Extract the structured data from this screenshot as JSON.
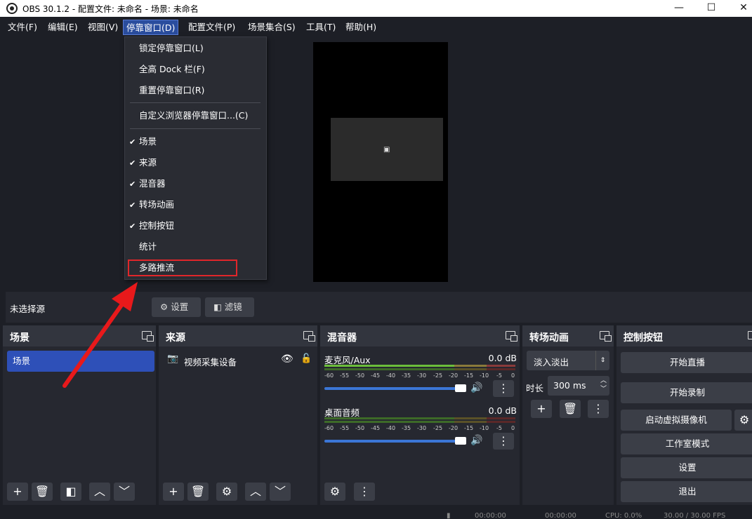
{
  "window": {
    "title": "OBS 30.1.2 - 配置文件: 未命名 - 场景: 未命名",
    "minimize": "—",
    "maximize": "☐",
    "close": "✕"
  },
  "menubar": {
    "items": [
      {
        "label": "文件(F)"
      },
      {
        "label": "编辑(E)"
      },
      {
        "label": "视图(V)"
      },
      {
        "label": "停靠窗口(D)"
      },
      {
        "label": "配置文件(P)"
      },
      {
        "label": "场景集合(S)"
      },
      {
        "label": "工具(T)"
      },
      {
        "label": "帮助(H)"
      }
    ]
  },
  "dock_menu": {
    "items": [
      {
        "label": "锁定停靠窗口(L)",
        "checked": false
      },
      {
        "label": "全高 Dock 栏(F)",
        "checked": false
      },
      {
        "label": "重置停靠窗口(R)",
        "checked": false
      },
      {
        "label": "自定义浏览器停靠窗口...(C)",
        "checked": false
      },
      {
        "label": "场景",
        "checked": true
      },
      {
        "label": "来源",
        "checked": true
      },
      {
        "label": "混音器",
        "checked": true
      },
      {
        "label": "转场动画",
        "checked": true
      },
      {
        "label": "控制按钮",
        "checked": true
      },
      {
        "label": "统计",
        "checked": false
      },
      {
        "label": "多路推流",
        "checked": false
      }
    ],
    "check_glyph": "✔"
  },
  "source_toolbar": {
    "no_source": "未选择源",
    "settings_label": "设置",
    "filters_label": "滤镜"
  },
  "scenes_dock": {
    "title": "场景",
    "items": [
      {
        "label": "场景"
      }
    ]
  },
  "sources_dock": {
    "title": "来源",
    "items": [
      {
        "label": "视频采集设备"
      }
    ]
  },
  "mixer_dock": {
    "title": "混音器",
    "channels": [
      {
        "name": "麦克风/Aux",
        "db": "0.0 dB"
      },
      {
        "name": "桌面音频",
        "db": "0.0 dB"
      }
    ],
    "ticks": [
      "-60",
      "-55",
      "-50",
      "-45",
      "-40",
      "-35",
      "-30",
      "-25",
      "-20",
      "-15",
      "-10",
      "-5",
      "0"
    ]
  },
  "transitions_dock": {
    "title": "转场动画",
    "selected": "淡入淡出",
    "duration_label": "时长",
    "duration_value": "300 ms"
  },
  "controls_dock": {
    "title": "控制按钮",
    "buttons": [
      {
        "label": "开始直播"
      },
      {
        "label": "开始录制"
      },
      {
        "label": "启动虚拟摄像机"
      },
      {
        "label": "工作室模式"
      },
      {
        "label": "设置"
      },
      {
        "label": "退出"
      }
    ]
  },
  "statusbar": {
    "rec_time": "00:00:00",
    "live_time": "00:00:00",
    "cpu": "CPU: 0.0%",
    "fps": "30.00 / 30.00 FPS"
  },
  "colors": {
    "accent": "#2e50b8",
    "highlight_box": "#e0262a",
    "arrow": "#e8191b",
    "meter_green": "#6bbd3a",
    "meter_yellow": "#c2a23a",
    "meter_red": "#c23a3a"
  }
}
